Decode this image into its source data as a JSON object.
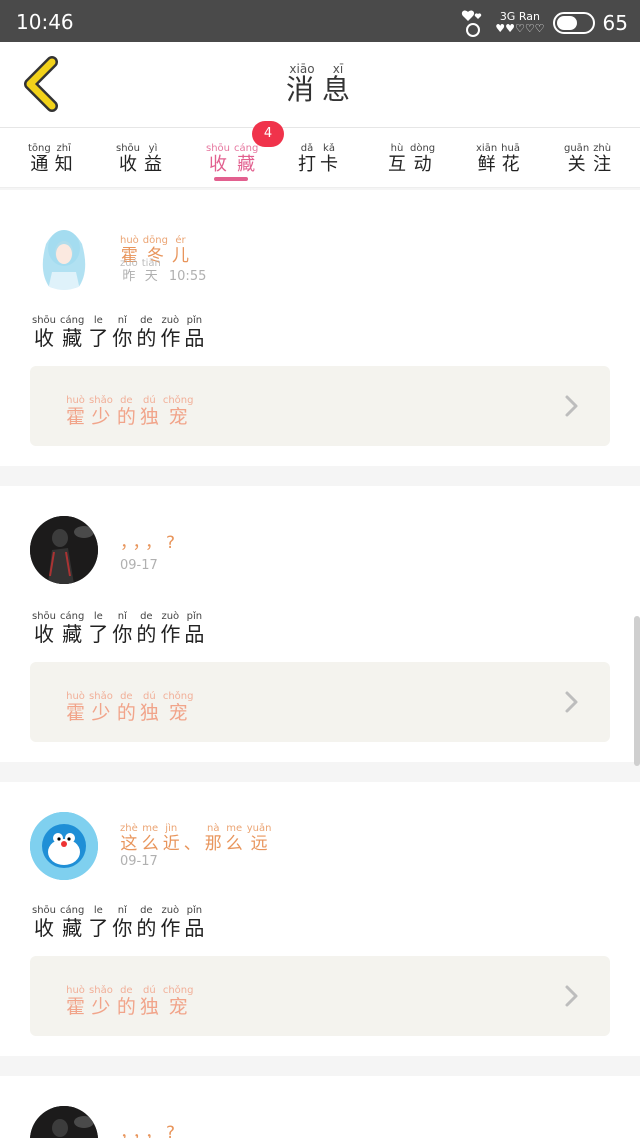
{
  "status_bar": {
    "time": "10:46",
    "network": "3G Ran",
    "battery": "65",
    "battery_level": 0.65
  },
  "header": {
    "title_chars": [
      {
        "hz": "消",
        "py": "xiāo"
      },
      {
        "hz": "息",
        "py": "xī"
      }
    ]
  },
  "tabs": [
    {
      "chars": [
        {
          "hz": "通",
          "py": "tōng"
        },
        {
          "hz": "知",
          "py": "zhī"
        }
      ]
    },
    {
      "chars": [
        {
          "hz": "收",
          "py": "shōu"
        },
        {
          "hz": "益",
          "py": "yì"
        }
      ]
    },
    {
      "chars": [
        {
          "hz": "收",
          "py": "shōu"
        },
        {
          "hz": "藏",
          "py": "cáng"
        }
      ],
      "badge": "4"
    },
    {
      "chars": [
        {
          "hz": "打",
          "py": "dǎ"
        },
        {
          "hz": "卡",
          "py": "kǎ"
        }
      ]
    },
    {
      "chars": [
        {
          "hz": "互",
          "py": "hù"
        },
        {
          "hz": "动",
          "py": "dòng"
        }
      ]
    },
    {
      "chars": [
        {
          "hz": "鲜",
          "py": "xiān"
        },
        {
          "hz": "花",
          "py": "huā"
        }
      ]
    },
    {
      "chars": [
        {
          "hz": "关",
          "py": "guān"
        },
        {
          "hz": "注",
          "py": "zhù"
        }
      ]
    }
  ],
  "notifications": [
    {
      "user_chars": [
        {
          "hz": "霍",
          "py": "huò"
        },
        {
          "hz": "冬",
          "py": "dōng"
        },
        {
          "hz": "儿",
          "py": "ér"
        }
      ],
      "time_chars": [
        {
          "hz": "昨",
          "py": "zuó"
        },
        {
          "hz": "天",
          "py": "tiān"
        }
      ],
      "time": "10:55",
      "action_chars": [
        {
          "hz": "收",
          "py": "shōu"
        },
        {
          "hz": "藏",
          "py": "cáng"
        },
        {
          "hz": "了",
          "py": "le"
        },
        {
          "hz": "你",
          "py": "nǐ"
        },
        {
          "hz": "的",
          "py": "de"
        },
        {
          "hz": "作",
          "py": "zuò"
        },
        {
          "hz": "品",
          "py": "pǐn"
        }
      ],
      "work_chars": [
        {
          "hz": "霍",
          "py": "huò"
        },
        {
          "hz": "少",
          "py": "shǎo"
        },
        {
          "hz": "的",
          "py": "de"
        },
        {
          "hz": "独",
          "py": "dú"
        },
        {
          "hz": "宠",
          "py": "chǒng"
        }
      ]
    },
    {
      "user_name": "，，，?",
      "time": "09-17",
      "action_chars": [
        {
          "hz": "收",
          "py": "shōu"
        },
        {
          "hz": "藏",
          "py": "cáng"
        },
        {
          "hz": "了",
          "py": "le"
        },
        {
          "hz": "你",
          "py": "nǐ"
        },
        {
          "hz": "的",
          "py": "de"
        },
        {
          "hz": "作",
          "py": "zuò"
        },
        {
          "hz": "品",
          "py": "pǐn"
        }
      ],
      "work_chars": [
        {
          "hz": "霍",
          "py": "huò"
        },
        {
          "hz": "少",
          "py": "shǎo"
        },
        {
          "hz": "的",
          "py": "de"
        },
        {
          "hz": "独",
          "py": "dú"
        },
        {
          "hz": "宠",
          "py": "chǒng"
        }
      ]
    },
    {
      "user_chars": [
        {
          "hz": "这",
          "py": "zhè"
        },
        {
          "hz": "么",
          "py": "me"
        },
        {
          "hz": "近",
          "py": "jìn"
        },
        {
          "hz": "、",
          "py": ""
        },
        {
          "hz": "那",
          "py": "nà"
        },
        {
          "hz": "么",
          "py": "me"
        },
        {
          "hz": "远",
          "py": "yuǎn"
        }
      ],
      "time": "09-17",
      "action_chars": [
        {
          "hz": "收",
          "py": "shōu"
        },
        {
          "hz": "藏",
          "py": "cáng"
        },
        {
          "hz": "了",
          "py": "le"
        },
        {
          "hz": "你",
          "py": "nǐ"
        },
        {
          "hz": "的",
          "py": "de"
        },
        {
          "hz": "作",
          "py": "zuò"
        },
        {
          "hz": "品",
          "py": "pǐn"
        }
      ],
      "work_chars": [
        {
          "hz": "霍",
          "py": "huò"
        },
        {
          "hz": "少",
          "py": "shǎo"
        },
        {
          "hz": "的",
          "py": "de"
        },
        {
          "hz": "独",
          "py": "dú"
        },
        {
          "hz": "宠",
          "py": "chǒng"
        }
      ]
    },
    {
      "user_name": "，，，?"
    }
  ],
  "colors": {
    "accent_pink": "#e2608f",
    "badge_red": "#f0334b",
    "name_orange": "#e8955c",
    "work_title": "#f1a48a",
    "work_bg": "#f4f3ee",
    "back_arrow": "#f2d21a"
  }
}
